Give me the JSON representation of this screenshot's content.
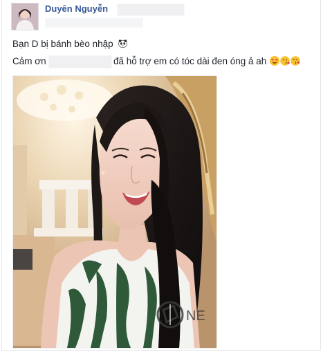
{
  "post": {
    "author_name": "Duyên Nguyễn",
    "line1": "Bạn D bị bánh bèo nhập",
    "line2_prefix": "Cảm ơn",
    "line2_suffix": "đã hỗ trợ em có tóc dài đen óng ả ah",
    "line1_emoji": "panda-emoji",
    "line2_emojis": [
      "heart-eyes-emoji",
      "kiss-emoji",
      "kiss-wink-emoji"
    ]
  },
  "photo": {
    "subject": "selfie-photo",
    "watermark": "NE"
  }
}
